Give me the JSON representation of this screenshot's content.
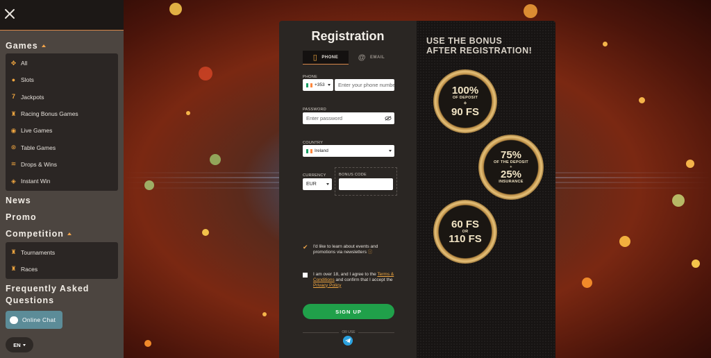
{
  "sidebar": {
    "close_icon": "close-icon",
    "sections": {
      "games": "Games",
      "news": "News",
      "promo": "Promo",
      "competition": "Competition",
      "faq_line1": "Frequently Asked",
      "faq_line2": "Questions"
    },
    "game_items": [
      {
        "label": "All",
        "icon": "grid-icon"
      },
      {
        "label": "Slots",
        "icon": "cherries-icon"
      },
      {
        "label": "Jackpots",
        "icon": "seven-icon"
      },
      {
        "label": "Racing Bonus Games",
        "icon": "trophy-icon"
      },
      {
        "label": "Live Games",
        "icon": "live-signal-icon"
      },
      {
        "label": "Table Games",
        "icon": "chip-icon"
      },
      {
        "label": "Drops & Wins",
        "icon": "coins-icon"
      },
      {
        "label": "Instant Win",
        "icon": "gamepad-icon"
      }
    ],
    "competition_items": [
      {
        "label": "Tournaments",
        "icon": "trophy-icon"
      },
      {
        "label": "Races",
        "icon": "trophy-icon"
      }
    ],
    "chat_label": "Online Chat",
    "language": "EN"
  },
  "registration": {
    "title": "Registration",
    "tabs": {
      "phone": "PHONE",
      "email": "EMAIL"
    },
    "phone": {
      "label": "PHONE",
      "code": "+353",
      "placeholder": "Enter your phone number"
    },
    "password": {
      "label": "PASSWORD",
      "placeholder": "Enter password"
    },
    "country": {
      "label": "COUNTRY",
      "value": "Ireland"
    },
    "currency": {
      "label": "CURRENCY",
      "value": "EUR"
    },
    "bonus_code": {
      "label": "BONUS CODE",
      "value": ""
    },
    "newsletter_text": "I'd like to learn about events and promotions via newsletters",
    "age_text_1": "I am over 18, and I agree to the",
    "terms_link": "Terms & Conditions",
    "age_text_2": "and confirm that I accept the",
    "privacy_link": "Privacy Policy",
    "signup_label": "SIGN UP",
    "or_use": "OR USE"
  },
  "promo": {
    "title_line1": "USE THE BONUS",
    "title_line2": "AFTER REGISTRATION!",
    "medal1": {
      "line1": "100%",
      "line2": "OF DEPOSIT",
      "line3": "+",
      "line4": "90 FS"
    },
    "medal2": {
      "line1": "75%",
      "line2": "OF THE DEPOSIT",
      "line3": "+",
      "line4": "25%",
      "line5": "INSURANCE"
    },
    "medal3": {
      "line1": "60 FS",
      "line2": "OR",
      "line3": "110 FS"
    }
  },
  "colors": {
    "accent": "#f0a640",
    "signup": "#20a04a",
    "chat": "#5c8c98"
  }
}
